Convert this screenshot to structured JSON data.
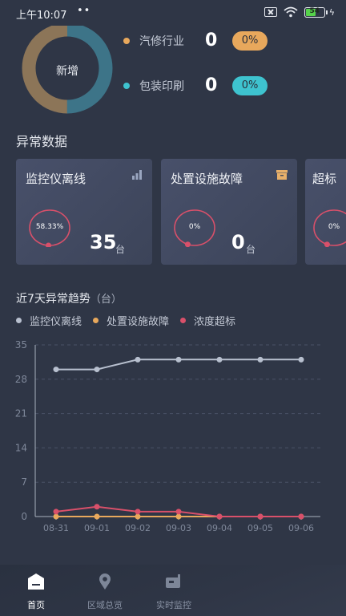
{
  "status_bar": {
    "time": "上午10:07",
    "dots": "••",
    "battery": "54"
  },
  "overview": {
    "center_label": "新增",
    "donut_colors": [
      "#8c7558",
      "#3d7488"
    ],
    "items": [
      {
        "name": "汽修行业",
        "count": "0",
        "percent": "0%",
        "color": "#e8a85c"
      },
      {
        "name": "包装印刷",
        "count": "0",
        "percent": "0%",
        "color": "#3ec3cf"
      }
    ]
  },
  "abnormal": {
    "title": "异常数据",
    "cards": [
      {
        "title": "监控仪离线",
        "ring_text": "58.33%",
        "count": "35",
        "unit": "台",
        "icon": "bar-chart-icon",
        "progress": 0.5833
      },
      {
        "title": "处置设施故障",
        "ring_text": "0%",
        "count": "0",
        "unit": "台",
        "icon": "archive-box-icon",
        "progress": 0
      },
      {
        "title": "超标",
        "ring_text": "0%",
        "count": "",
        "unit": "",
        "icon": "",
        "progress": 0
      }
    ]
  },
  "trend": {
    "title": "近7天异常趋势",
    "unit": "（台）",
    "legend": [
      {
        "name": "监控仪离线",
        "color": "#b8c0cf"
      },
      {
        "name": "处置设施故障",
        "color": "#e8a85c"
      },
      {
        "name": "浓度超标",
        "color": "#d9506a"
      }
    ]
  },
  "chart_data": {
    "type": "line",
    "x": [
      "08-31",
      "09-01",
      "09-02",
      "09-03",
      "09-04",
      "09-05",
      "09-06"
    ],
    "ylim": [
      0,
      35
    ],
    "yticks": [
      0,
      7,
      14,
      21,
      28,
      35
    ],
    "grid": true,
    "series": [
      {
        "name": "监控仪离线",
        "color": "#b8c0cf",
        "values": [
          30,
          30,
          32,
          32,
          32,
          32,
          32
        ]
      },
      {
        "name": "处置设施故障",
        "color": "#e8a85c",
        "values": [
          0,
          0,
          0,
          0,
          0,
          0,
          0
        ]
      },
      {
        "name": "浓度超标",
        "color": "#d9506a",
        "values": [
          1,
          2,
          1,
          1,
          0,
          0,
          0
        ]
      }
    ]
  },
  "tabs": [
    {
      "label": "首页",
      "icon": "home-icon",
      "active": true
    },
    {
      "label": "区域总览",
      "icon": "location-pin-icon",
      "active": false
    },
    {
      "label": "实时监控",
      "icon": "monitor-device-icon",
      "active": false
    }
  ]
}
